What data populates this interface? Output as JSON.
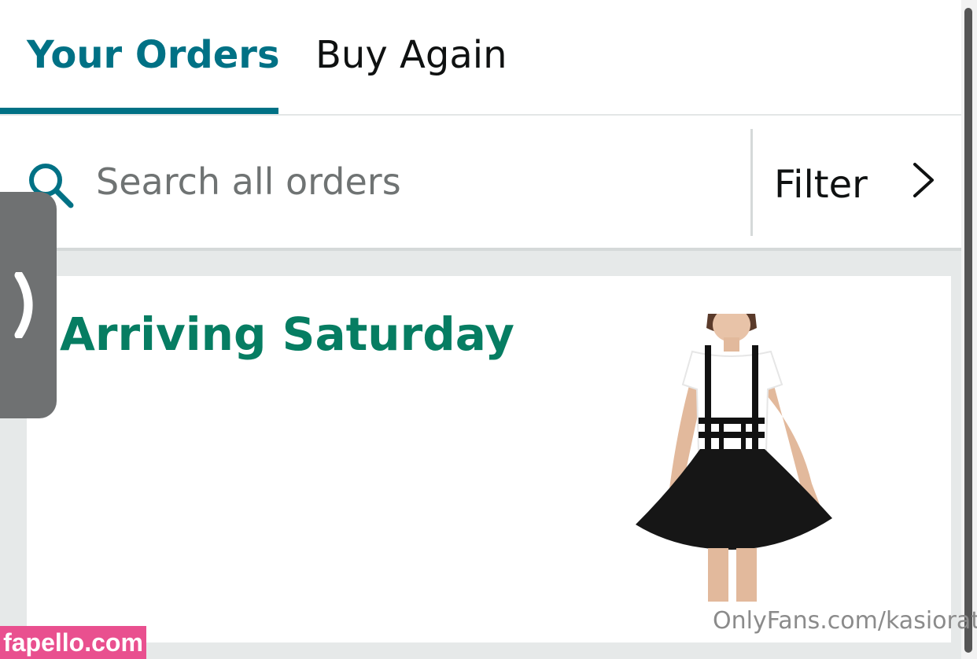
{
  "tabs": {
    "your_orders": "Your Orders",
    "buy_again": "Buy Again",
    "active": "your_orders"
  },
  "search": {
    "placeholder": "Search all orders",
    "icon": "search-icon"
  },
  "filter": {
    "label": "Filter",
    "icon": "chevron-right-icon"
  },
  "order": {
    "status": "Arriving Saturday",
    "image_alt": "suspender skirt"
  },
  "side_handle": {
    "icon": "chevron-right-icon"
  },
  "watermarks": {
    "right": "OnlyFans.com/kasiorat",
    "left": "fapello.com"
  },
  "colors": {
    "accent_teal": "#007185",
    "arriving_green": "#067d62",
    "text_dark": "#0f1111",
    "placeholder_gray": "#6f7373",
    "watermark_pink": "#e9508f"
  }
}
